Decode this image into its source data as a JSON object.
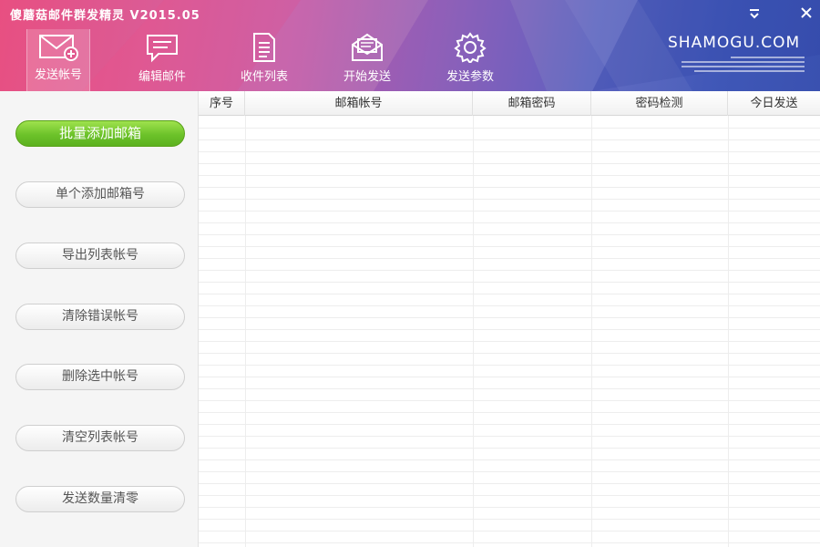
{
  "app": {
    "title": "傻蘑菇邮件群发精灵 V2015.05"
  },
  "window": {
    "minimize_glyph": "⎯",
    "close_glyph": "✕"
  },
  "toolbar": {
    "items": [
      {
        "label": "发送帐号",
        "icon": "mail-add-icon",
        "active": true
      },
      {
        "label": "编辑邮件",
        "icon": "chat-bubble-icon",
        "active": false
      },
      {
        "label": "收件列表",
        "icon": "document-list-icon",
        "active": false
      },
      {
        "label": "开始发送",
        "icon": "mail-open-icon",
        "active": false
      },
      {
        "label": "发送参数",
        "icon": "gear-icon",
        "active": false
      }
    ]
  },
  "brand": {
    "name": "SHAMOGU.COM"
  },
  "sidebar": {
    "buttons": [
      {
        "label": "批量添加邮箱",
        "primary": true
      },
      {
        "label": "单个添加邮箱号",
        "primary": false
      },
      {
        "label": "导出列表帐号",
        "primary": false
      },
      {
        "label": "清除错误帐号",
        "primary": false
      },
      {
        "label": "删除选中帐号",
        "primary": false
      },
      {
        "label": "清空列表帐号",
        "primary": false
      },
      {
        "label": "发送数量清零",
        "primary": false
      }
    ]
  },
  "table": {
    "columns": [
      "序号",
      "邮箱帐号",
      "邮箱密码",
      "密码检测",
      "今日发送"
    ],
    "rows": []
  },
  "colors": {
    "header_start": "#e7457a",
    "header_end": "#3a51b0",
    "primary_button": "#6cc22a"
  }
}
